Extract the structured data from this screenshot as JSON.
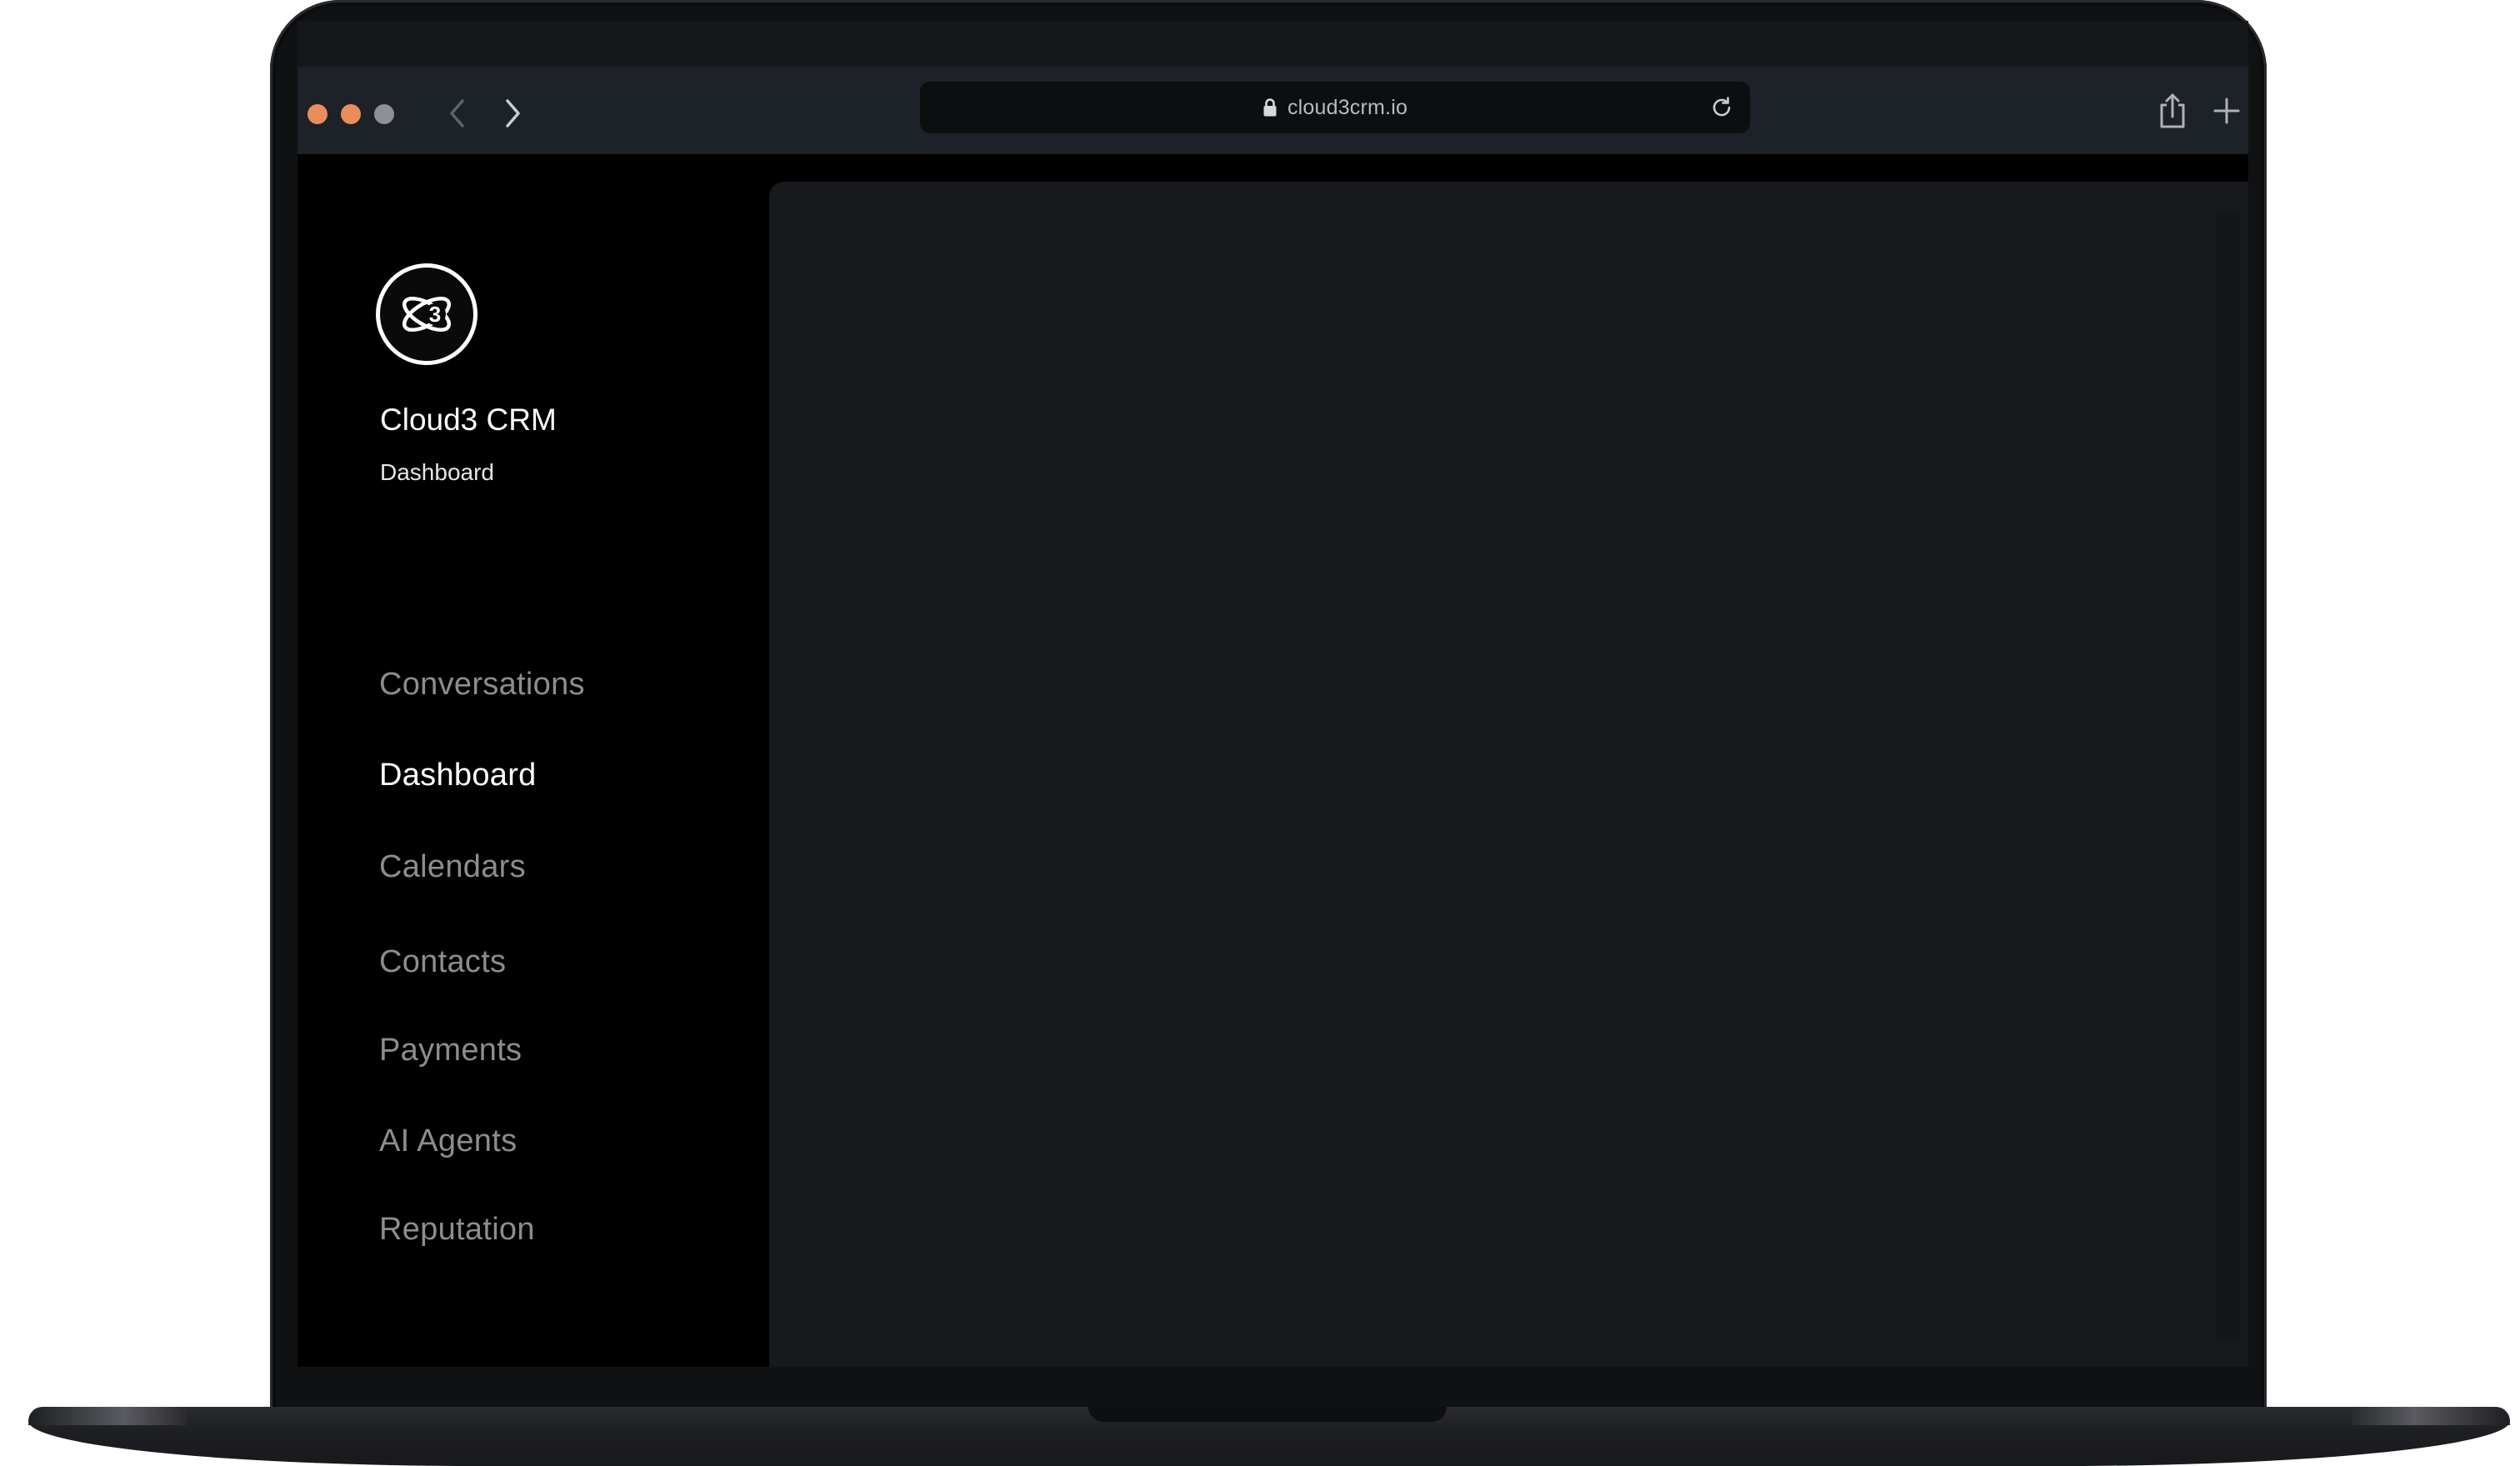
{
  "browser": {
    "url": "cloud3crm.io"
  },
  "app": {
    "brand_title": "Cloud3 CRM",
    "brand_subtitle": "Dashboard",
    "logo_mark": "3"
  },
  "sidebar": {
    "items": [
      {
        "label": "Conversations",
        "active": false
      },
      {
        "label": "Dashboard",
        "active": true
      },
      {
        "label": "Calendars",
        "active": false
      },
      {
        "label": "Contacts",
        "active": false
      },
      {
        "label": "Payments",
        "active": false
      },
      {
        "label": "AI Agents",
        "active": false
      },
      {
        "label": "Reputation",
        "active": false
      }
    ]
  },
  "colors": {
    "traffic_light_accent": "#e98e5a",
    "traffic_light_inactive": "#8e9092",
    "toolbar_bg": "#1d2128",
    "main_panel_bg": "#17191d",
    "sidebar_bg": "#000000",
    "nav_inactive": "#8b8d91",
    "nav_active": "#ffffff"
  },
  "icons": {
    "lock": "lock-icon",
    "reload": "reload-icon",
    "share": "share-icon",
    "new_tab": "plus-icon",
    "back": "chevron-left-icon",
    "forward": "chevron-right-icon",
    "logo": "atom-three-logo"
  }
}
